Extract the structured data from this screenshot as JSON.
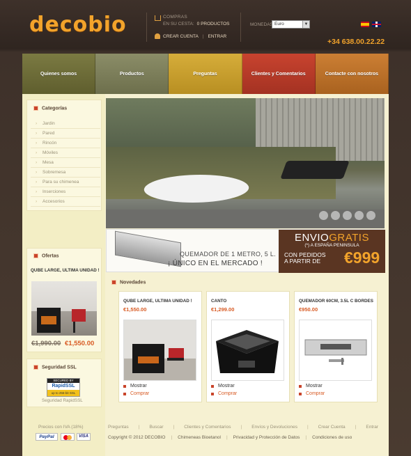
{
  "header": {
    "logo": "decobio",
    "cart_title": "COMPRAS",
    "cart_label": "EN SU CESTA:",
    "cart_count": "0 PRODUCTOS",
    "create_account": "CREAR CUENTA",
    "separator": "|",
    "login": "ENTRAR",
    "currency_label": "MONEDAS:",
    "currency_value": "Euro",
    "phone": "+34 638.00.22.22"
  },
  "nav": [
    "Quienes somos",
    "Productos",
    "Preguntas",
    "Clientes y Comentarios",
    "Contacte con nosotros"
  ],
  "categories": {
    "title": "Categorías",
    "items": [
      "Jardin",
      "Pared",
      "Rincón",
      "Móviles",
      "Mesa",
      "Sobremesa",
      "Para su chimenea",
      "Inserciones",
      "Accesorios"
    ]
  },
  "offers": {
    "title": "Ofertas",
    "product": "QUBE LARGE, ULTIMA UNIDAD !",
    "old_price": "€1,990.00",
    "new_price": "€1,550.00"
  },
  "ssl": {
    "title": "Seguridad SSL",
    "badge_top": "SECURED BY",
    "badge_brand": "RapidSSL",
    "badge_bottom": "up to 256-bit SSL",
    "label": "Seguridad RapidSSL"
  },
  "banner": {
    "line1": "QUEMADOR DE 1 METRO, 5 L.",
    "line2": "¡ ÚNICO EN EL MERCADO !",
    "envio": "ENVIO",
    "gratis": "GRATIS",
    "envio_sub": "(*) A ESPAÑA PENINSULA",
    "con": "CON PEDIDOS",
    "partir": "A PARTIR DE",
    "amount": "€999"
  },
  "novedades": {
    "title": "Novedades",
    "products": [
      {
        "name": "QUBE LARGE, ULTIMA UNIDAD !",
        "price": "€1,550.00",
        "show": "Mostrar",
        "buy": "Comprar"
      },
      {
        "name": "CANTO",
        "price": "€1,299.00",
        "show": "Mostrar",
        "buy": "Comprar"
      },
      {
        "name": "QUEMADOR 60CM, 3.5L C BORDES",
        "price": "€950.00",
        "show": "Mostrar",
        "buy": "Comprar"
      }
    ]
  },
  "footer": {
    "precios": "Precios con IVA (18%)",
    "paypal": "PayPal",
    "visa": "VISA",
    "links": [
      "Preguntas",
      "Buscar",
      "Clientes y Comentarios",
      "Envíos y Devoluciones",
      "Crear Cuenta",
      "Entrar"
    ],
    "copyright": "Copyright © 2012 DECOBIO",
    "links2": [
      "Chimeneas Bioetanol",
      "Privacidad y Protección de Datos",
      "Condiciones de uso"
    ],
    "separator": "|"
  },
  "colors": {
    "accent": "#f2a32b",
    "price": "#d85a23",
    "bullet": "#c9442a"
  }
}
